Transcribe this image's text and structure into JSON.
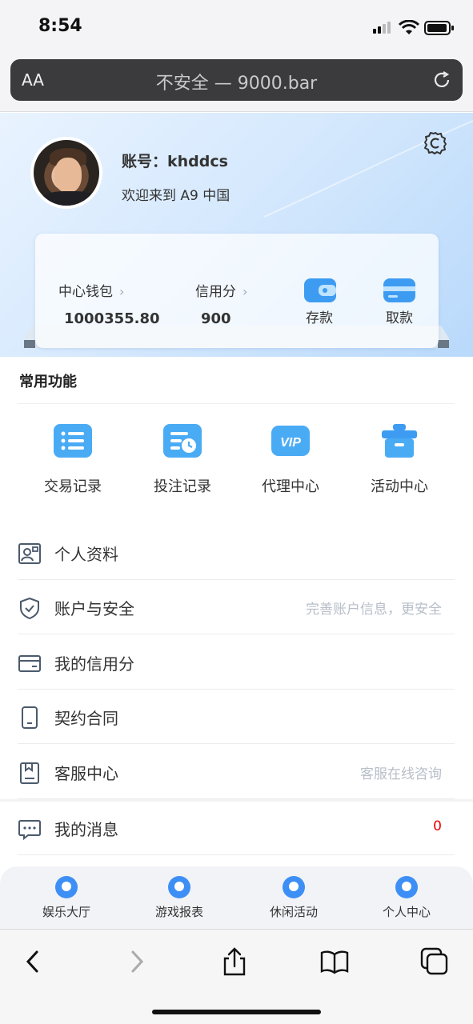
{
  "status_bar": {
    "time": "8:54"
  },
  "browser": {
    "aa_label": "AA",
    "url_text": "不安全 — 9000.bar"
  },
  "profile": {
    "account_label": "账号：",
    "account_name": "khddcs",
    "welcome": "欢迎来到 A9 中国"
  },
  "wallet": {
    "center_wallet_label": "中心钱包",
    "center_wallet_value": "1000355.80",
    "credit_label": "信用分",
    "credit_value": "900",
    "deposit_label": "存款",
    "withdraw_label": "取款"
  },
  "common": {
    "title": "常用功能",
    "items": [
      {
        "label": "交易记录",
        "icon": "list-icon"
      },
      {
        "label": "投注记录",
        "icon": "bet-record-icon"
      },
      {
        "label": "代理中心",
        "icon": "vip-icon"
      },
      {
        "label": "活动中心",
        "icon": "gift-icon"
      }
    ]
  },
  "menu": [
    {
      "label": "个人资料",
      "hint": "",
      "icon": "profile-card-icon"
    },
    {
      "label": "账户与安全",
      "hint": "完善账户信息，更安全",
      "icon": "shield-icon"
    },
    {
      "label": "我的信用分",
      "hint": "",
      "icon": "card-icon"
    },
    {
      "label": "契约合同",
      "hint": "",
      "icon": "contract-icon"
    },
    {
      "label": "客服中心",
      "hint": "客服在线咨询",
      "icon": "service-icon"
    },
    {
      "label": "我的消息",
      "badge": "0",
      "icon": "message-icon"
    }
  ],
  "tabs": [
    {
      "label": "娱乐大厅"
    },
    {
      "label": "游戏报表"
    },
    {
      "label": "休闲活动"
    },
    {
      "label": "个人中心"
    }
  ],
  "colors": {
    "accent": "#3d8ff5",
    "badge": "#e00000",
    "hint": "#b7bec8"
  }
}
